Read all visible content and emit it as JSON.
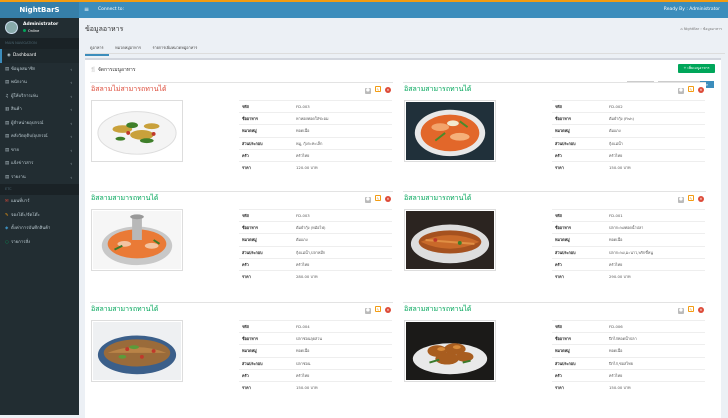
{
  "app": {
    "logo": "NightBarS",
    "top_center": "Connect to:",
    "top_right": "Ready By : Administrator"
  },
  "user": {
    "name": "Administrator",
    "status": "Online"
  },
  "sidebar": {
    "header1": "MAIN NAVIGATION",
    "header2": "ETC",
    "items": [
      {
        "label": "Dashboard",
        "icon": "dashboard-icon",
        "glyph": "◉"
      },
      {
        "label": "ข้อมูลสมาชิก",
        "icon": "users-icon",
        "glyph": "▤"
      },
      {
        "label": "พนักงาน",
        "icon": "user-icon",
        "glyph": "▤"
      },
      {
        "label": "ผู้ให้บริการเล่น",
        "icon": "music-icon",
        "glyph": "♫"
      },
      {
        "label": "สินค้า",
        "icon": "box-icon",
        "glyph": "▥"
      },
      {
        "label": "ผู้จำหน่ายอุปกรณ์",
        "icon": "truck-icon",
        "glyph": "▤"
      },
      {
        "label": "คลังวัตถุดิบ/อุปกรณ์",
        "icon": "archive-icon",
        "glyph": "▤"
      },
      {
        "label": "ขาย",
        "icon": "cart-icon",
        "glyph": "▤"
      },
      {
        "label": "แจ้งข่าวสาร",
        "icon": "bell-icon",
        "glyph": "▤"
      },
      {
        "label": "รายงาน",
        "icon": "print-icon",
        "glyph": "▤"
      }
    ],
    "etc_items": [
      {
        "label": "แผนที่บาร์",
        "icon": "map-icon",
        "glyph": "✉",
        "color": "#dd4b39"
      },
      {
        "label": "จองโต๊ะ/จัดโต๊ะ",
        "icon": "table-icon",
        "glyph": "✎",
        "color": "#f39c12"
      },
      {
        "label": "ตั้งค่าการบันทึกสินค้า",
        "icon": "settings-icon",
        "glyph": "◆",
        "color": "#3c8dbc"
      },
      {
        "label": "รายการสั่ง",
        "icon": "list-icon",
        "glyph": "○",
        "color": "#00a65a"
      }
    ]
  },
  "page": {
    "title": "ข้อมูลอาหาร",
    "breadcrumb": "⌂ NightBar  ›  ข้อมูลอาหาร"
  },
  "tabs": [
    "ดูอาหาร",
    "หมวดหมู่อาหาร",
    "รายการเพิ่มหมวดหมู่อาหาร"
  ],
  "panel": {
    "title": "จัดการเมนูอาหาร",
    "add_button": "+ เพิ่มเมนูอาหาร",
    "show_select": "ทั้ง",
    "search_placeholder": "Search"
  },
  "field_labels": {
    "code": "รหัส",
    "name": "ชื่ออาหาร",
    "category": "หมวดหมู่",
    "ingredient": "ส่วนประกอบ",
    "origin": "ครัว",
    "price": "ราคา"
  },
  "cards": [
    {
      "title": "อิสลามไม่สามารถทานได้",
      "title_color": "#dd4b39",
      "code": "FD-003",
      "name": "หาหอยทอดใส่ชะอม",
      "category": "ทอดเนื้อ",
      "ingredient": "หมู, กุ้งกะทะเล็ก",
      "origin": "ครัวไทย",
      "price": "120.00 บาท"
    },
    {
      "title": "อิสลามสามารถทานได้",
      "title_color": "#00a65a",
      "code": "FD-002",
      "name": "ต้มยำกุ้ง (Fish)",
      "category": "ต้มแกง",
      "ingredient": "กุ้งแม่น้ำ",
      "origin": "ครัวไทย",
      "price": "150.00 บาท"
    },
    {
      "title": "อิสลามสามารถทานได้",
      "title_color": "#00a65a",
      "code": "FD-003",
      "name": "ต้มยำกุ้ง (หม้อไฟ)",
      "category": "ต้มแกง",
      "ingredient": "กุ้งแม่น้ำ,ปลาหมึก",
      "origin": "ครัวไทย",
      "price": "280.00 บาท"
    },
    {
      "title": "อิสลามสามารถทานได้",
      "title_color": "#00a65a",
      "code": "FD-001",
      "name": "ปลากะพงทอดน้ำปลา",
      "category": "ทอดเนื้อ",
      "ingredient": "ปลากะพง,มะนาว,พริกขี้หนู",
      "origin": "ครัวไทย",
      "price": "290.00 บาท"
    },
    {
      "title": "อิสลามสามารถทานได้",
      "title_color": "#00a65a",
      "code": "FD-004",
      "name": "ปลาช่อนลุยสวน",
      "category": "ทอดเนื้อ",
      "ingredient": "ปลาช่อน",
      "origin": "ครัวไทย",
      "price": "150.00 บาท"
    },
    {
      "title": "อิสลามสามารถทานได้",
      "title_color": "#00a65a",
      "code": "FD-006",
      "name": "ปีกไก่ทอดน้ำปลา",
      "category": "ทอดเนื้อ",
      "ingredient": "ปีกไก่,ซอสไทย",
      "origin": "ครัวไทย",
      "price": "150.00 บาท"
    }
  ]
}
